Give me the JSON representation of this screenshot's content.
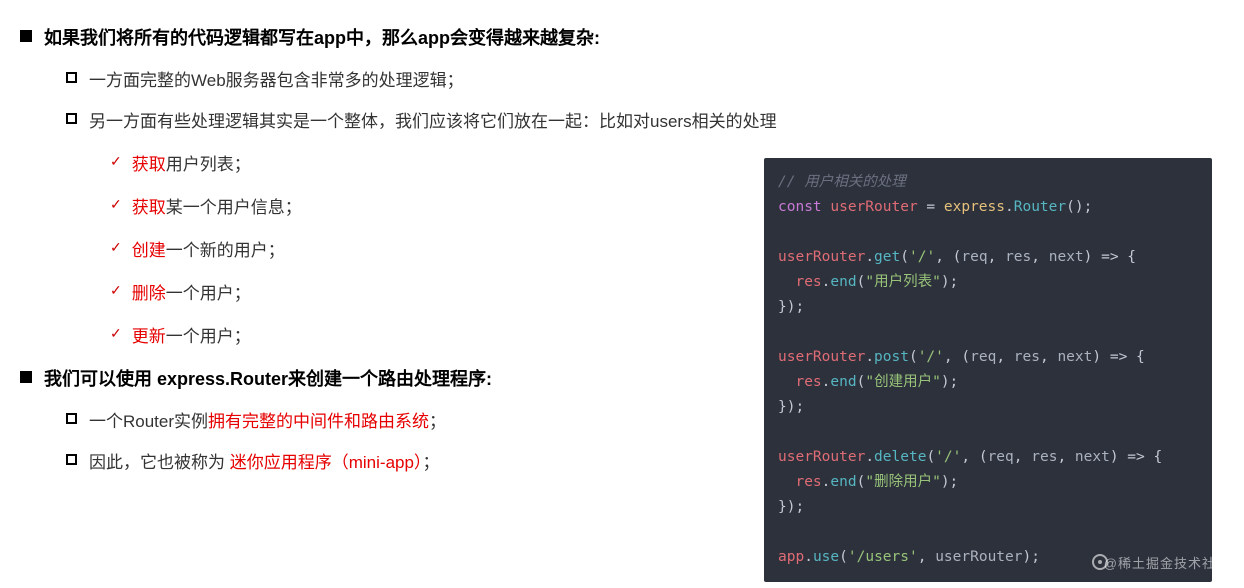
{
  "main1": "如果我们将所有的代码逻辑都写在app中，那么app会变得越来越复杂:",
  "sub1": "一方面完整的Web服务器包含非常多的处理逻辑；",
  "sub2": "另一方面有些处理逻辑其实是一个整体，我们应该将它们放在一起：比如对users相关的处理",
  "chk1a": "获取",
  "chk1b": "用户列表；",
  "chk2a": "获取",
  "chk2b": "某一个用户信息；",
  "chk3a": "创建",
  "chk3b": "一个新的用户；",
  "chk4a": "删除",
  "chk4b": "一个用户；",
  "chk5a": "更新",
  "chk5b": "一个用户；",
  "main2": "我们可以使用 express.Router来创建一个路由处理程序:",
  "sub3a": "一个Router实例",
  "sub3b": "拥有完整的中间件和路由系统",
  "sub3c": "；",
  "sub4a": "因此，它也被称为 ",
  "sub4b": "迷你应用程序（mini-app）",
  "sub4c": "；",
  "watermark": "@稀土掘金技术社区",
  "code": {
    "cmt": "// 用户相关的处理",
    "l1_kw": "const",
    "l1_var": " userRouter ",
    "l1_eq": "= ",
    "l1_obj": "express",
    "l1_dot": ".",
    "l1_fn": "Router",
    "l1_end": "();",
    "g_obj": "userRouter",
    "g_dot": ".",
    "get_fn": "get",
    "post_fn": "post",
    "del_fn": "delete",
    "args_open": "(",
    "path": "'/'",
    "comma": ", ",
    "lp": "(",
    "p_req": "req",
    "p_res": "res",
    "p_next": "next",
    "rp": ")",
    "arrow": " => {",
    "res_var": "res",
    "end_fn": "end",
    "s_list": "\"用户列表\"",
    "s_create": "\"创建用户\"",
    "s_delete": "\"删除用户\"",
    "close_paren": ");",
    "close_brace": "});",
    "app": "app",
    "use_fn": "use",
    "use_path": "'/users'",
    "use_arg": "userRouter",
    "use_end": ");"
  }
}
